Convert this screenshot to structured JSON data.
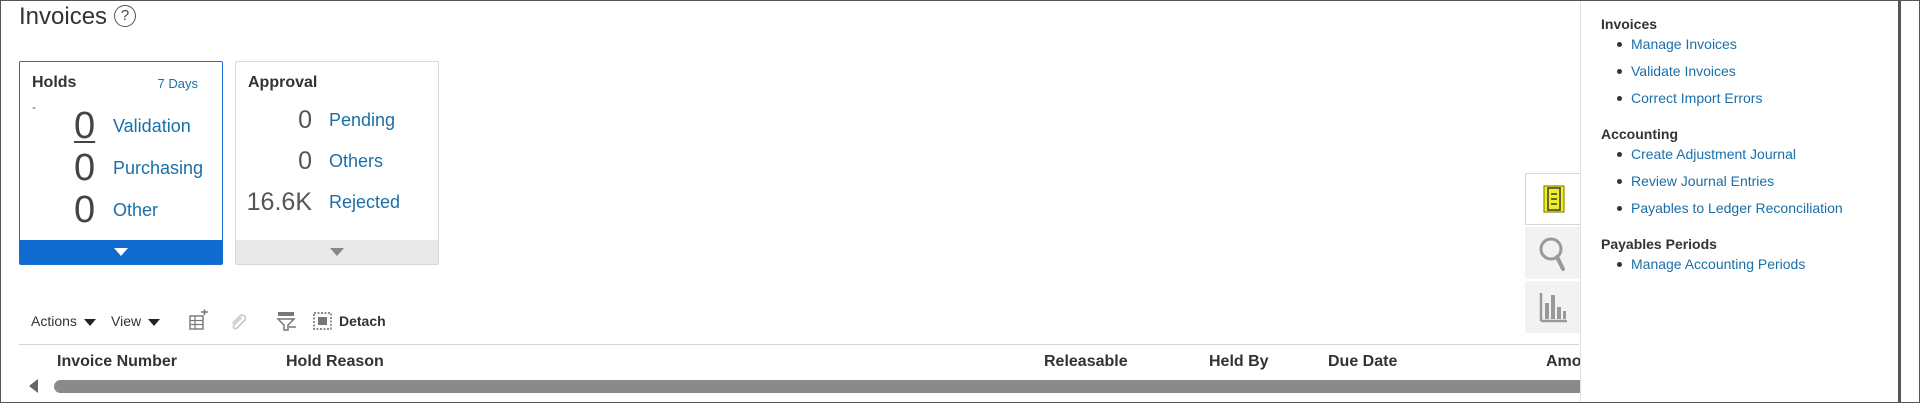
{
  "page": {
    "title": "Invoices",
    "help_icon": "?"
  },
  "holds_card": {
    "title": "Holds",
    "period_link": "7 Days",
    "dash": "-",
    "metrics": [
      {
        "value": "0",
        "label": "Validation"
      },
      {
        "value": "0",
        "label": "Purchasing"
      },
      {
        "value": "0",
        "label": "Other"
      }
    ],
    "footer_color": "#0f6bd0"
  },
  "approval_card": {
    "title": "Approval",
    "metrics": [
      {
        "value": "0",
        "label": "Pending"
      },
      {
        "value": "0",
        "label": "Others"
      },
      {
        "value": "16.6K",
        "label": "Rejected"
      }
    ]
  },
  "toolbar": {
    "actions_label": "Actions",
    "view_label": "View",
    "detach_label": "Detach"
  },
  "table": {
    "columns": [
      "Invoice Number",
      "Hold Reason",
      "Releasable",
      "Held By",
      "Due Date",
      "Amo"
    ]
  },
  "side_tabs": {
    "icons": [
      "tasks-icon",
      "search-icon",
      "bar-chart-icon"
    ],
    "active": "tasks-icon"
  },
  "task_panel": {
    "sections": [
      {
        "title": "Invoices",
        "items": [
          "Manage Invoices",
          "Validate Invoices",
          "Correct Import Errors"
        ]
      },
      {
        "title": "Accounting",
        "items": [
          "Create Adjustment Journal",
          "Review Journal Entries",
          "Payables to Ledger Reconciliation"
        ]
      },
      {
        "title": "Payables Periods",
        "items": [
          "Manage Accounting Periods"
        ]
      }
    ]
  },
  "colors": {
    "link": "#1a6fa8",
    "accent_blue": "#0f6bd0",
    "highlight_yellow": "#f2ef1e"
  }
}
